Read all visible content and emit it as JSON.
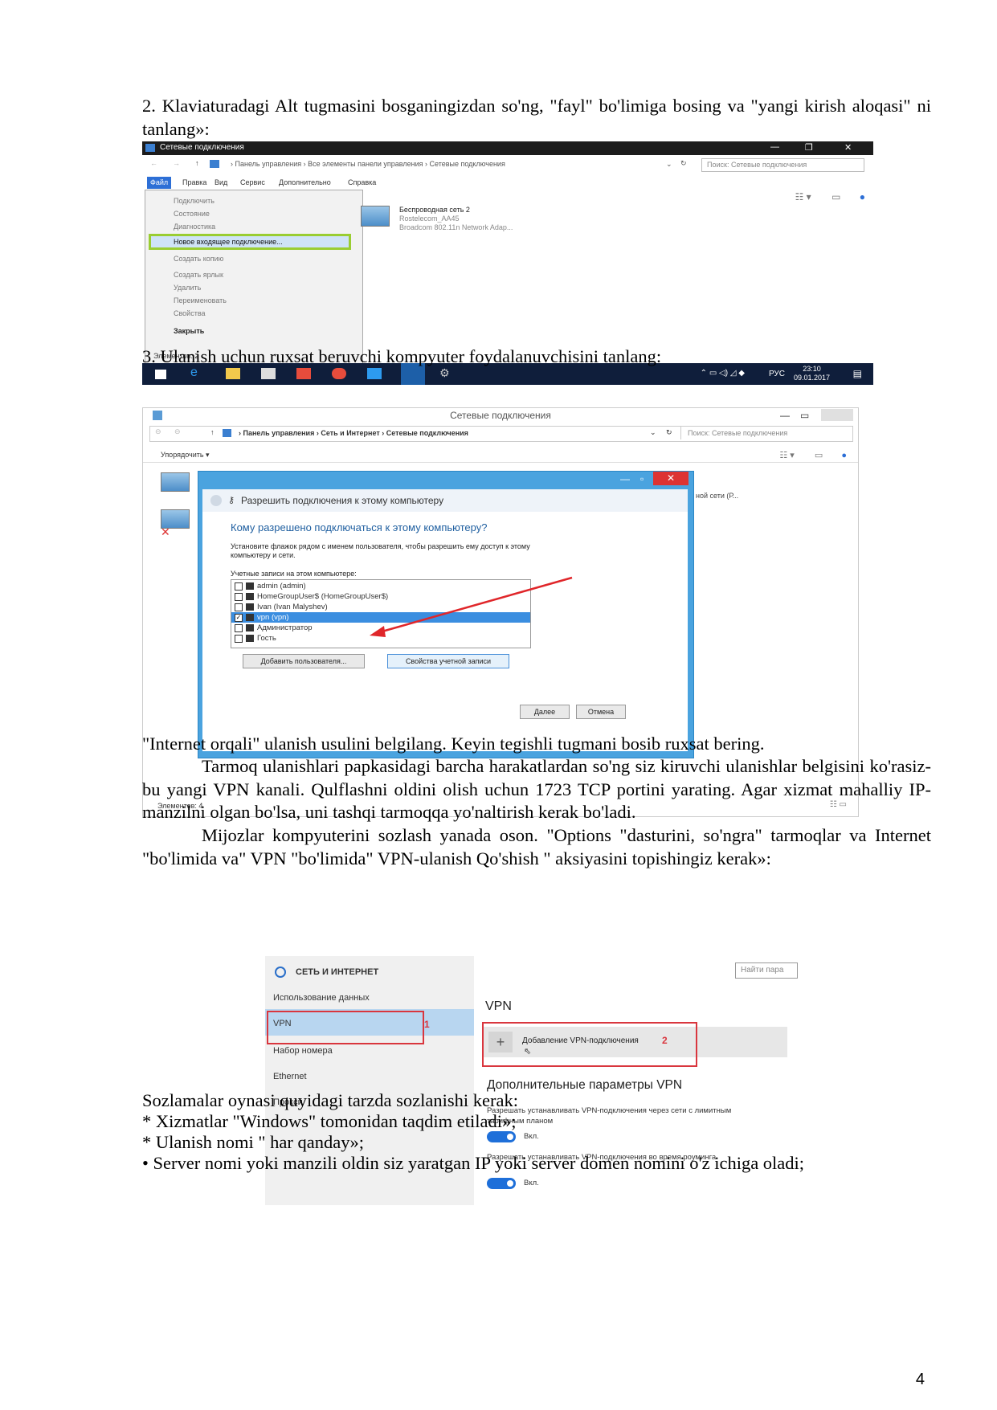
{
  "doc": {
    "step2": "2. Klaviaturadagi Alt tugmasini bosganingizdan so'ng, \"fayl\" bo'limiga bosing va \"yangi kirish aloqasi\" ni tanlang»:",
    "step3": "3. Ulanish uchun ruxsat beruvchi kompyuter foydalanuvchisini tanlang:",
    "p_internet": "\"Internet orqali\" ulanish usulini belgilang. Keyin tegishli tugmani bosib ruxsat bering.",
    "p_tarmoq": "Tarmoq ulanishlari papkasidagi barcha harakatlardan so'ng siz kiruvchi ulanishlar belgisini ko'rasiz-bu yangi VPN kanali. Qulflashni oldini olish uchun 1723 TCP portini yarating. Agar xizmat mahalliy IP-manzilni olgan bo'lsa, uni tashqi tarmoqqa yo'naltirish kerak bo'ladi.",
    "p_mijoz": "Mijozlar kompyuterini sozlash yanada oson. \"Options \"dasturini, so'ngra\" tarmoqlar va Internet \"bo'limida va\" VPN \"bo'limida\" VPN-ulanish Qo'shish \" aksiyasini topishingiz kerak»:",
    "list_intro": "Sozlamalar oynasi quyidagi tarzda sozlanishi kerak:",
    "list": [
      "* Xizmatlar \"Windows\" tomonidan taqdim etiladi»;",
      "* Ulanish nomi \" har qanday»;",
      "• Server nomi yoki manzili oldin siz yaratgan IP yoki server domen nomini o'z ichiga oladi;"
    ],
    "page_number": "4"
  },
  "shot1": {
    "title": "Сетевые подключения",
    "breadcrumb": "›  Панель управления  ›  Все элементы панели управления  ›  Сетевые подключения",
    "search": "Поиск: Сетевые подключения",
    "menu": [
      "Файл",
      "Правка",
      "Вид",
      "Сервис",
      "Дополнительно",
      "Справка"
    ],
    "dropdown": [
      "Подключить",
      "Состояние",
      "Диагностика",
      "Новое входящее подключение...",
      "Создать копию",
      "Создать ярлык",
      "Удалить",
      "Переименовать",
      "Свойства",
      "Закрыть"
    ],
    "network": [
      "Беспроводная сеть 2",
      "Rostelecom_AA45",
      "Broadcom 802.11n Network Adap..."
    ],
    "status": "Элементов: 2",
    "taskbar_lang": "РУС",
    "time": "23:10",
    "date": "09.01.2017"
  },
  "shot2": {
    "title": "Сетевые подключения",
    "breadcrumb": "›  Панель управления  ›  Сеть и Интернет  ›  Сетевые подключения",
    "search": "Поиск: Сетевые подключения",
    "organize": "Упорядочить ▾",
    "side_text": "ной сети (Р...",
    "status": "Элементов: 4",
    "dialog": {
      "header": "Разрешить подключения к этому компьютеру",
      "question": "Кому разрешено подключаться к этому компьютеру?",
      "desc": "Установите флажок рядом с именем пользователя, чтобы разрешить ему доступ к этому компьютеру и сети.",
      "accounts_label": "Учетные записи на этом компьютере:",
      "accounts": [
        "admin (admin)",
        "HomeGroupUser$ (HomeGroupUser$)",
        "Ivan (Ivan Malyshev)",
        "vpn (vpn)",
        "Администратор",
        "Гость"
      ],
      "checked": [
        false,
        false,
        false,
        true,
        false,
        false
      ],
      "add_user": "Добавить пользователя...",
      "account_props": "Свойства учетной записи",
      "next": "Далее",
      "cancel": "Отмена"
    }
  },
  "shot3": {
    "header": "СЕТЬ И ИНТЕРНЕТ",
    "find": "Найти пара",
    "menu": [
      "Использование данных",
      "VPN",
      "Набор номера",
      "Ethernet",
      "Прокси"
    ],
    "vpn_title": "VPN",
    "add_vpn": "Добавление VPN-подключения",
    "marker1": "1",
    "marker2": "2",
    "adv_title": "Дополнительные параметры VPN",
    "opt1": "Разрешать устанавливать VPN-подключения через сети с лимитным тарифным планом",
    "opt2": "Разрешать устанавливать VPN-подключения во время роуминга",
    "on": "Вкл."
  }
}
